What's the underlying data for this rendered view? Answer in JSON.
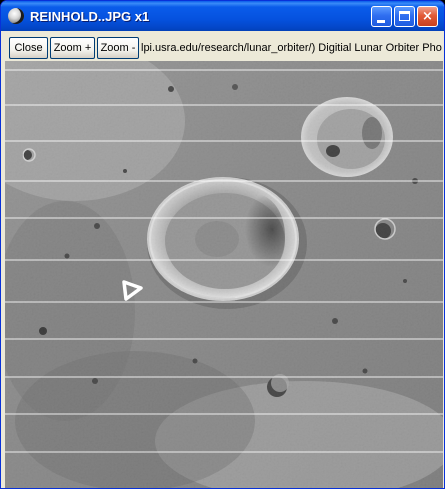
{
  "window": {
    "title": "REINHOLD..JPG x1",
    "controls": {
      "minimize": "minimize",
      "maximize": "maximize",
      "close": "×"
    }
  },
  "toolbar": {
    "close_label": "Close",
    "zoom_in_label": "Zoom +",
    "zoom_out_label": "Zoom -",
    "status_text": "lpi.usra.edu/research/lunar_orbiter/)  Digitial Lunar Orbiter Photo"
  },
  "image": {
    "subject": "lunar orbiter photograph of crater Reinhold",
    "icons": [
      "moon-icon",
      "minimize-icon",
      "maximize-icon",
      "close-icon"
    ]
  }
}
